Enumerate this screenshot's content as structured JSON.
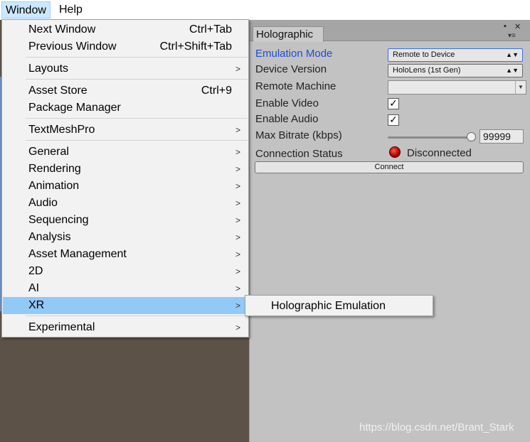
{
  "menubar": {
    "window_label": "Window",
    "help_label": "Help"
  },
  "window_menu": {
    "groups": [
      [
        {
          "label": "Next Window",
          "shortcut": "Ctrl+Tab"
        },
        {
          "label": "Previous Window",
          "shortcut": "Ctrl+Shift+Tab"
        }
      ],
      [
        {
          "label": "Layouts",
          "submenu": true
        }
      ],
      [
        {
          "label": "Asset Store",
          "shortcut": "Ctrl+9"
        },
        {
          "label": "Package Manager"
        }
      ],
      [
        {
          "label": "TextMeshPro",
          "submenu": true
        }
      ],
      [
        {
          "label": "General",
          "submenu": true
        },
        {
          "label": "Rendering",
          "submenu": true
        },
        {
          "label": "Animation",
          "submenu": true
        },
        {
          "label": "Audio",
          "submenu": true
        },
        {
          "label": "Sequencing",
          "submenu": true
        },
        {
          "label": "Analysis",
          "submenu": true
        },
        {
          "label": "Asset Management",
          "submenu": true
        },
        {
          "label": "2D",
          "submenu": true
        },
        {
          "label": "AI",
          "submenu": true
        },
        {
          "label": "XR",
          "submenu": true,
          "highlighted": true
        }
      ],
      [
        {
          "label": "Experimental",
          "submenu": true
        }
      ]
    ]
  },
  "xr_submenu": {
    "items": [
      "Holographic Emulation"
    ]
  },
  "holographic_panel": {
    "tab_label": "Holographic",
    "emulation_mode": {
      "label": "Emulation Mode",
      "value": "Remote to Device"
    },
    "device_version": {
      "label": "Device Version",
      "value": "HoloLens (1st Gen)"
    },
    "remote_machine": {
      "label": "Remote Machine",
      "value": ""
    },
    "enable_video": {
      "label": "Enable Video",
      "checked": true
    },
    "enable_audio": {
      "label": "Enable Audio",
      "checked": true
    },
    "max_bitrate": {
      "label": "Max Bitrate (kbps)",
      "value": "99999",
      "slider_fraction": 1.0
    },
    "connection_status": {
      "label": "Connection Status",
      "value": "Disconnected",
      "indicator_color": "#d00000"
    },
    "connect_button": "Connect"
  },
  "watermark": "https://blog.csdn.net/Brant_Stark",
  "colors": {
    "menu_highlight": "#91c9f7",
    "active_label": "#1b4fd1"
  }
}
